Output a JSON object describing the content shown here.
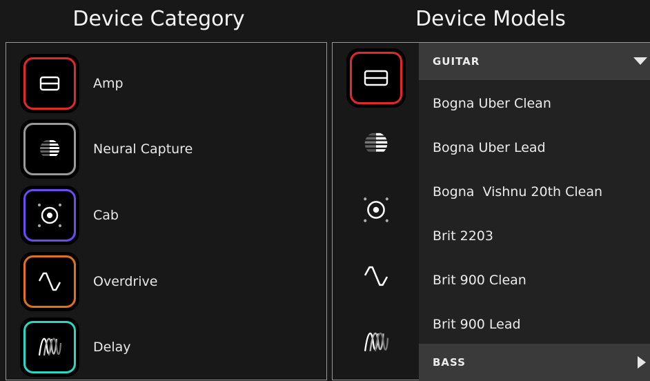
{
  "headings": {
    "category": "Device Category",
    "models": "Device Models"
  },
  "categories": [
    {
      "label": "Amp",
      "icon": "amp-icon",
      "color": "#e02a2a"
    },
    {
      "label": "Neural Capture",
      "icon": "neural-capture-icon",
      "color": "#9a9a9a"
    },
    {
      "label": "Cab",
      "icon": "cab-icon",
      "color": "#6a4cf0"
    },
    {
      "label": "Overdrive",
      "icon": "overdrive-icon",
      "color": "#e0721e"
    },
    {
      "label": "Delay",
      "icon": "delay-icon",
      "color": "#2bd8c4"
    }
  ],
  "models": {
    "groups": [
      {
        "label": "GUITAR",
        "expanded": true
      },
      {
        "label": "BASS",
        "expanded": false
      }
    ],
    "items": [
      "Bogna Uber Clean",
      "Bogna Uber Lead",
      "Bogna  Vishnu 20th Clean",
      "Brit 2203",
      "Brit 900 Clean",
      "Brit 900 Lead"
    ]
  },
  "colors": {
    "selected": "#e02a2a"
  }
}
